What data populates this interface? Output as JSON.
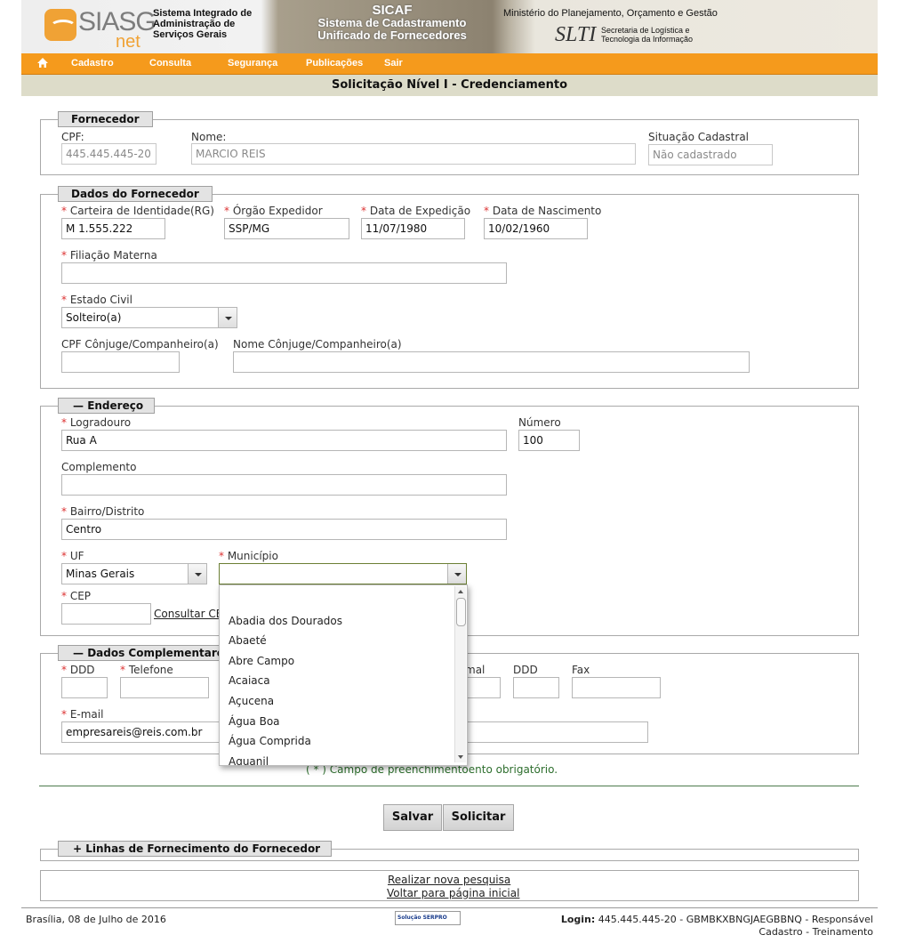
{
  "header": {
    "logo_siasg": "SIASG",
    "logo_net": "net",
    "system_name": [
      "Sistema Integrado de",
      "Administração de",
      "Serviços Gerais"
    ],
    "sicaf_title": "SICAF",
    "sicaf_subtitle": [
      "Sistema de Cadastramento",
      "Unificado de Fornecedores"
    ],
    "ministry": "Ministério do Planejamento, Orçamento e Gestão",
    "slti_logo": "SLTI",
    "slti_text": [
      "Secretaria de Logística e",
      "Tecnologia da Informação"
    ]
  },
  "menu": {
    "items": [
      "Cadastro",
      "Consulta",
      "Segurança",
      "Publicações",
      "Sair"
    ]
  },
  "page_title": "Solicitação Nível I - Credenciamento",
  "fornecedor": {
    "legend": "Fornecedor",
    "cpf_label": "CPF:",
    "cpf_value": "445.445.445-20",
    "nome_label": "Nome:",
    "nome_value": "MARCIO REIS",
    "situacao_label": "Situação Cadastral",
    "situacao_value": "Não cadastrado"
  },
  "dados_fornecedor": {
    "legend": "Dados do Fornecedor",
    "rg_label": "Carteira de Identidade(RG)",
    "rg_value": "M 1.555.222",
    "orgao_label": "Órgão Expedidor",
    "orgao_value": "SSP/MG",
    "data_exp_label": "Data de Expedição",
    "data_exp_value": "11/07/1980",
    "data_nasc_label": "Data de Nascimento",
    "data_nasc_value": "10/02/1960",
    "filiacao_label": "Filiação Materna",
    "filiacao_value": "",
    "estado_civil_label": "Estado Civil",
    "estado_civil_value": "Solteiro(a)",
    "cpf_conjuge_label": "CPF Cônjuge/Companheiro(a)",
    "nome_conjuge_label": "Nome Cônjuge/Companheiro(a)"
  },
  "endereco": {
    "legend": "Endereço",
    "logradouro_label": "Logradouro",
    "logradouro_value": "Rua A",
    "numero_label": "Número",
    "numero_value": "100",
    "complemento_label": "Complemento",
    "bairro_label": "Bairro/Distrito",
    "bairro_value": "Centro",
    "uf_label": "UF",
    "uf_value": "Minas Gerais",
    "municipio_label": "Município",
    "municipio_value": "",
    "cep_label": "CEP",
    "consultar_cep": "Consultar CE"
  },
  "municipio_options": [
    "",
    "Abadia dos Dourados",
    "Abaeté",
    "Abre Campo",
    "Acaiaca",
    "Açucena",
    "Água Boa",
    "Água Comprida",
    "Aguanil"
  ],
  "dados_complementares": {
    "legend": "Dados Complementares",
    "ddd_label": "DDD",
    "telefone_label": "Telefone",
    "ramal_label_visible": "mal",
    "ddd2_label": "DDD",
    "fax_label": "Fax",
    "email_label": "E-mail",
    "email_value": "empresareis@reis.com.br"
  },
  "required_note_start": "( * ) Campo de preenchimento",
  "required_note_end": "ento obrigatório.",
  "buttons": {
    "salvar": "Salvar",
    "solicitar": "Solicitar"
  },
  "linhas_legend": "Linhas de Fornecimento do Fornecedor",
  "links": {
    "nova_pesquisa": "Realizar nova pesquisa",
    "pagina_inicial": "Voltar para página inicial"
  },
  "footer": {
    "date": "Brasília, 08 de Julho de 2016",
    "serpro": "Solução SERPRO",
    "login_label": "Login:",
    "login_value": "445.445.445-20 - GBMBKXBNGJAEGBBNQ - Responsável",
    "login_line2": "Cadastro - Treinamento"
  },
  "colors": {
    "menu_bg": "#f59a1c",
    "title_bar_bg": "#dddcc9",
    "required": "#d33333",
    "note_green": "#2d6e2d"
  }
}
